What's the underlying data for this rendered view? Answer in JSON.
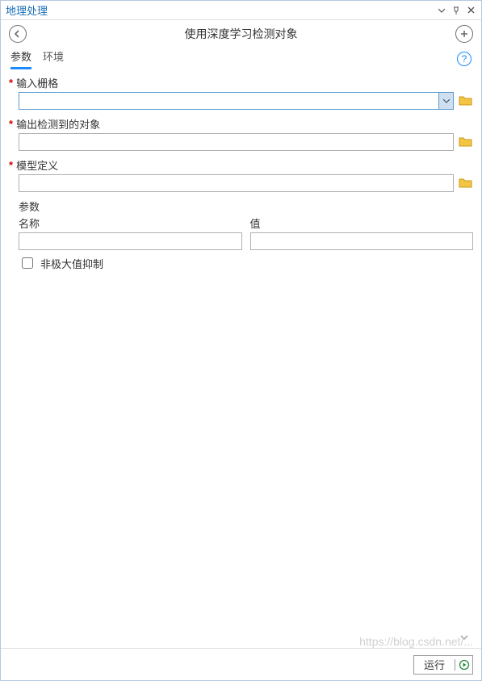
{
  "window": {
    "title": "地理处理"
  },
  "toolbar": {
    "tool_title": "使用深度学习检测对象"
  },
  "tabs": {
    "params": "参数",
    "env": "环境"
  },
  "fields": {
    "input_raster": {
      "label": "输入栅格",
      "value": ""
    },
    "output_detected": {
      "label": "输出检测到的对象",
      "value": ""
    },
    "model_def": {
      "label": "模型定义",
      "value": ""
    }
  },
  "args": {
    "header": "参数",
    "name_label": "名称",
    "value_label": "值",
    "name": "",
    "value": ""
  },
  "nms": {
    "label": "非极大值抑制",
    "checked": false
  },
  "footer": {
    "run_label": "运行"
  },
  "watermark": "https://blog.csdn.net/..."
}
